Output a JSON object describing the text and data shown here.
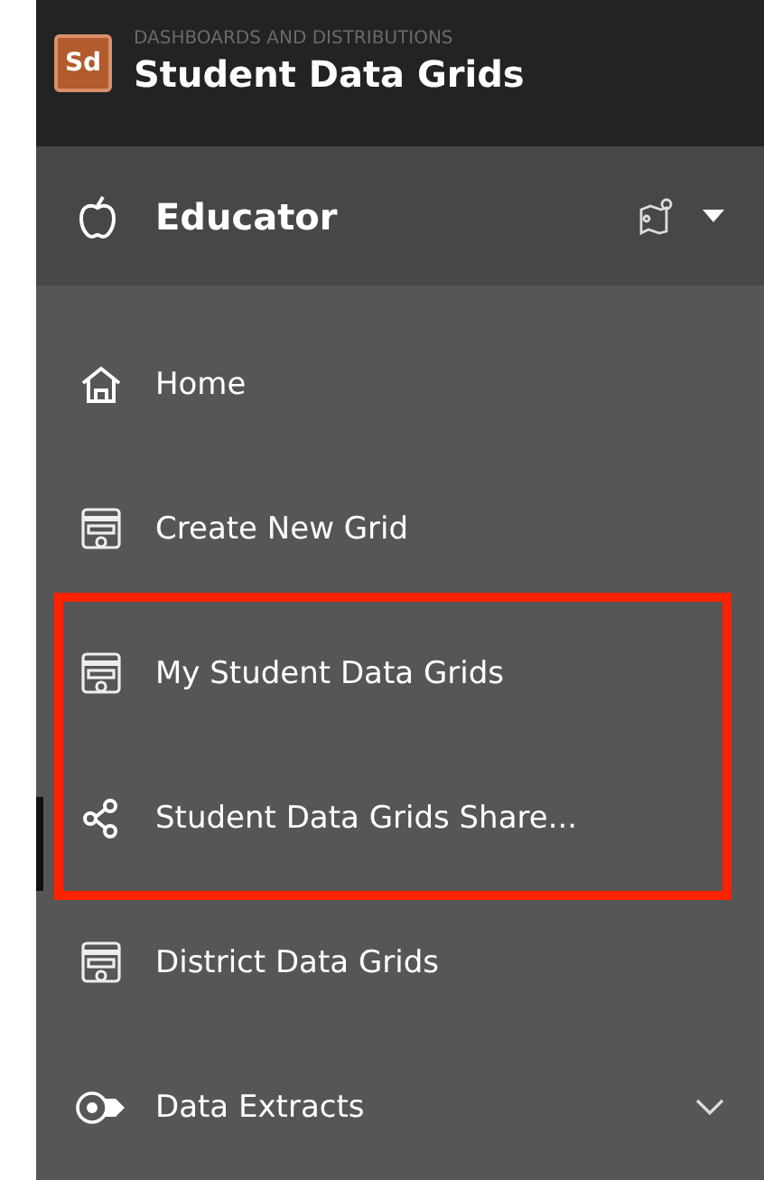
{
  "header": {
    "logo": "Sd",
    "subtitle": "DASHBOARDS AND DISTRIBUTIONS",
    "title": "Student Data Grids"
  },
  "role": {
    "label": "Educator",
    "menu_expanded": false
  },
  "nav": [
    {
      "kind": "home",
      "label": "Home",
      "selected": false,
      "highlighted": false
    },
    {
      "kind": "grid",
      "label": "Create New Grid",
      "selected": false,
      "highlighted": false
    },
    {
      "kind": "grid",
      "label": "My Student Data Grids",
      "selected": false,
      "highlighted": true
    },
    {
      "kind": "share",
      "label": "Student Data Grids Share...",
      "selected": true,
      "highlighted": true
    },
    {
      "kind": "grid",
      "label": "District Data Grids",
      "selected": false,
      "highlighted": false
    },
    {
      "kind": "extract",
      "label": "Data Extracts",
      "selected": false,
      "highlighted": false,
      "expanded": false
    }
  ]
}
